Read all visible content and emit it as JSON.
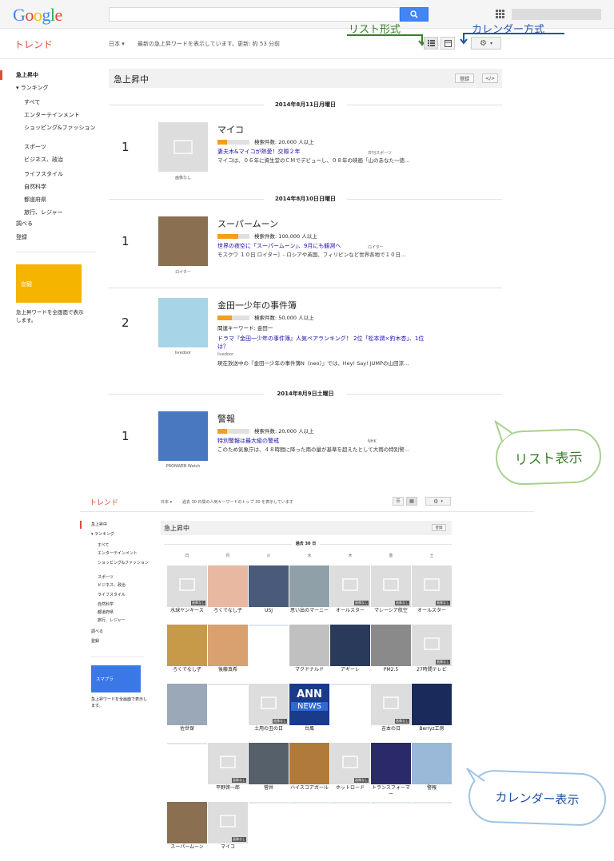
{
  "header": {
    "logo_letters": [
      "G",
      "o",
      "o",
      "g",
      "l",
      "e"
    ],
    "logo_colors": [
      "#4285f4",
      "#ea4335",
      "#fbbc05",
      "#4285f4",
      "#34a853",
      "#ea4335"
    ],
    "search_icon": "search-icon"
  },
  "subbar": {
    "title": "トレンド",
    "region": "日本 ▾",
    "status": "最新の急上昇ワードを表示しています。更新: 約 53 分前"
  },
  "annotations": {
    "list_mode": "リスト形式",
    "calendar_mode": "カレンダー方式",
    "list_view": "リスト表示",
    "calendar_view": "カレンダー表示"
  },
  "sidebar": {
    "items": [
      {
        "label": "急上昇中",
        "active": true
      },
      {
        "label": "▾ ランキング"
      },
      {
        "label": "すべて"
      },
      {
        "label": "エンターテインメント"
      },
      {
        "label": "ショッピング&ファッション"
      },
      {
        "label": "スポーツ"
      },
      {
        "label": "ビジネス、政治"
      },
      {
        "label": "ライフスタイル"
      },
      {
        "label": "自然科学"
      },
      {
        "label": "都道府県"
      },
      {
        "label": "旅行、レジャー"
      },
      {
        "label": "調べる"
      },
      {
        "label": "登録"
      }
    ],
    "promo_label": "宣観",
    "promo_text": "急上昇ワードを全画面で表示します。"
  },
  "panel": {
    "title": "急上昇中",
    "subscribe": "登録",
    "embed": "</>"
  },
  "list": {
    "dates": [
      "2014年8月11日月曜日",
      "2014年8月10日日曜日",
      "2014年8月9日土曜日"
    ],
    "entries": [
      {
        "rank": "1",
        "keyword": "マイコ",
        "searches": "検索件数: 20,000 人以上",
        "bar": 0.3,
        "link": "妻夫木&マイコが熱愛！交際２年",
        "source": "日刊スポーツ",
        "snippet": "マイコは、０６年に資生堂のＣＭでデビューし、０８年の映画「山のあなた〜徳…",
        "caption": "画像なし"
      },
      {
        "rank": "1",
        "keyword": "スーパームーン",
        "searches": "検索件数: 100,000 人以上",
        "bar": 0.65,
        "link": "世界の夜空に「スーパームーン」、9月にも観測へ",
        "source": "ロイター",
        "snippet": "モスクワ １０日 ロイター］- ロシアや英国、フィリピンなど世界各地で１０日…",
        "caption": "ロイター"
      },
      {
        "rank": "2",
        "keyword": "金田一少年の事件簿",
        "searches": "検索件数: 50,000 人以上",
        "bar": 0.45,
        "related": "関連キーワード: 金田一",
        "link": "ドラマ『金田一少年の事件簿』人気ペアランキング！ 2位「松本潤×釣木杏」、1位は？",
        "source": "livedoor",
        "snippet": "現在放送中の『金田一少年の事件簿N（neo）』では、Hey! Say! JUMPの山田涼…",
        "caption": "livedoor"
      },
      {
        "rank": "1",
        "keyword": "警報",
        "searches": "検索件数: 20,000 人以上",
        "bar": 0.3,
        "link": "特別警報は最大級の警戒",
        "source": "NHK",
        "snippet": "このため気象庁は、４８時間に降った雨の量が基準を超えたとして大雨の特別警…",
        "caption": "PRONWEB Watch"
      }
    ]
  },
  "calendar": {
    "title": "トレンド",
    "region": "日本 ▾",
    "status": "過去 30 日間の人気キーワードのトップ 30 を表示しています",
    "panel_title": "急上昇中",
    "subscribe": "登録",
    "period": "過去 30 日",
    "weekdays": [
      "日",
      "月",
      "火",
      "水",
      "木",
      "金",
      "土"
    ],
    "sidebar": [
      "急上昇中",
      "▾ ランキング",
      "すべて",
      "エンターテインメント",
      "ショッピング&ファッション",
      "スポーツ",
      "ビジネス、政治",
      "ライフスタイル",
      "自然科学",
      "都道府県",
      "旅行、レジャー",
      "調べる",
      "登録"
    ],
    "promo_label": "スマプラ",
    "promo_text": "急上昇ワードを全画面で表示します。",
    "nodata": "画像なし",
    "cells": [
      [
        {
          "l": "水球ヤンキース",
          "t": "ph"
        },
        {
          "l": "ろくでなし子",
          "t": "#e9b8a0"
        },
        {
          "l": "USJ",
          "t": "#4a5a7a"
        },
        {
          "l": "思い出のマーニー",
          "t": "#8fa0a8"
        },
        {
          "l": "オールスター",
          "t": "ph"
        },
        {
          "l": "マレーシア航空",
          "t": "ph"
        },
        {
          "l": "オールスター",
          "t": "ph"
        }
      ],
      [
        {
          "l": "ろくでなし子",
          "t": "#c79a4a"
        },
        {
          "l": "後藤真希",
          "t": "#d9a070"
        },
        {
          "l": "",
          "t": "empty"
        },
        {
          "l": "マクドナルド",
          "t": "#c0c0c0"
        },
        {
          "l": "アギーレ",
          "t": "#2a3a5a"
        },
        {
          "l": "PM2.5",
          "t": "#8a8a8a"
        },
        {
          "l": "27時間テレビ",
          "t": "ph"
        }
      ],
      [
        {
          "l": "佐世保",
          "t": "#9aa8b8"
        },
        {
          "l": "",
          "t": "empty"
        },
        {
          "l": "土用の丑の日",
          "t": "ph"
        },
        {
          "l": "台風",
          "t": "ann"
        },
        {
          "l": "",
          "t": "empty"
        },
        {
          "l": "吉本の日",
          "t": "ph"
        },
        {
          "l": "Berryz工房",
          "t": "#1a2a5a"
        }
      ],
      [
        {
          "l": "",
          "t": "empty"
        },
        {
          "l": "平野啓一郎",
          "t": "ph"
        },
        {
          "l": "菅井",
          "t": "#55606a"
        },
        {
          "l": "ハイスコアガール",
          "t": "#b07a3a"
        },
        {
          "l": "ホットロード",
          "t": "ph"
        },
        {
          "l": "トランスフォーマー",
          "t": "#2a2a6a"
        },
        {
          "l": "警報",
          "t": "#9ab8d8"
        }
      ],
      [
        {
          "l": "スーパームーン",
          "t": "#8a7050"
        },
        {
          "l": "マイコ",
          "t": "ph"
        },
        {
          "l": "",
          "t": "empty"
        },
        {
          "l": "",
          "t": "empty"
        },
        {
          "l": "",
          "t": "empty"
        },
        {
          "l": "",
          "t": "empty"
        },
        {
          "l": "",
          "t": "empty"
        }
      ]
    ]
  }
}
